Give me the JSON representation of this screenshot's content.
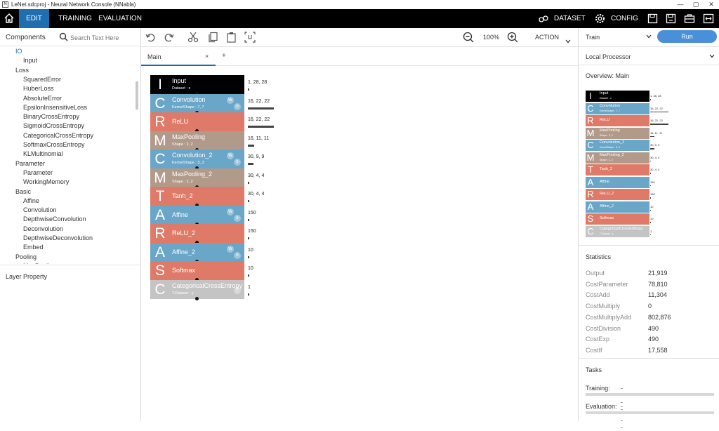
{
  "window": {
    "title": "LeNet.sdcproj - Neural Network Console (NNabla)",
    "icon_letter": "N",
    "controls": [
      "—",
      "▢",
      "✕"
    ]
  },
  "menu": {
    "home_icon": "home-icon",
    "tabs": [
      "EDIT",
      "TRAINING",
      "EVALUATION"
    ],
    "dataset_label": "DATASET",
    "config_label": "CONFIG",
    "accent": "#1f6fb0"
  },
  "components": {
    "title": "Components",
    "search_placeholder": "Search Text Here",
    "items": [
      {
        "label": "IO",
        "level": 0,
        "selected": true
      },
      {
        "label": "Input",
        "level": 1
      },
      {
        "label": "Loss",
        "level": 0
      },
      {
        "label": "SquaredError",
        "level": 1
      },
      {
        "label": "HuberLoss",
        "level": 1
      },
      {
        "label": "AbsoluteError",
        "level": 1
      },
      {
        "label": "EpsilonInsensitiveLoss",
        "level": 1
      },
      {
        "label": "BinaryCrossEntropy",
        "level": 1
      },
      {
        "label": "SigmoidCrossEntropy",
        "level": 1
      },
      {
        "label": "CategoricalCrossEntropy",
        "level": 1
      },
      {
        "label": "SoftmaxCrossEntropy",
        "level": 1
      },
      {
        "label": "KLMultinomial",
        "level": 1
      },
      {
        "label": "Parameter",
        "level": 0
      },
      {
        "label": "Parameter",
        "level": 1
      },
      {
        "label": "WorkingMemory",
        "level": 1
      },
      {
        "label": "Basic",
        "level": 0
      },
      {
        "label": "Affine",
        "level": 1
      },
      {
        "label": "Convolution",
        "level": 1
      },
      {
        "label": "DepthwiseConvolution",
        "level": 1
      },
      {
        "label": "Deconvolution",
        "level": 1
      },
      {
        "label": "DepthwiseDeconvolution",
        "level": 1
      },
      {
        "label": "Embed",
        "level": 1
      },
      {
        "label": "Pooling",
        "level": 0
      },
      {
        "label": "MaxPooling",
        "level": 1
      }
    ]
  },
  "layer_property": {
    "title": "Layer Property"
  },
  "toolbar": {
    "zoom_level": "100%",
    "action_label": "ACTION"
  },
  "tabs": {
    "main_label": "Main",
    "close": "×",
    "add": "+"
  },
  "network": {
    "layers": [
      {
        "letter": "I",
        "name": "Input",
        "sub": "Dataset : x",
        "color": "#000000",
        "shape": "1, 28, 28",
        "bar": 0.05,
        "wb": ""
      },
      {
        "letter": "C",
        "name": "Convolution",
        "sub": "KernelShape : 7, 7",
        "color": "#6aa6c8",
        "shape": "16, 22, 22",
        "bar": 0.93,
        "wb": "wb"
      },
      {
        "letter": "R",
        "name": "ReLU",
        "sub": "",
        "color": "#e07a68",
        "shape": "16, 22, 22",
        "bar": 0.93,
        "wb": ""
      },
      {
        "letter": "M",
        "name": "MaxPooling",
        "sub": "Shape : 2, 2",
        "color": "#b29a8a",
        "shape": "16, 11, 11",
        "bar": 0.23,
        "wb": ""
      },
      {
        "letter": "C",
        "name": "Convolution_2",
        "sub": "KernelShape : 3, 3",
        "color": "#6aa6c8",
        "shape": "30, 9, 9",
        "bar": 0.2,
        "wb": "wb"
      },
      {
        "letter": "M",
        "name": "MaxPooling_2",
        "sub": "Shape : 2, 2",
        "color": "#b29a8a",
        "shape": "30, 4, 4",
        "bar": 0.05,
        "wb": ""
      },
      {
        "letter": "T",
        "name": "Tanh_2",
        "sub": "",
        "color": "#e07a68",
        "shape": "30, 4, 4",
        "bar": 0.05,
        "wb": ""
      },
      {
        "letter": "A",
        "name": "Affine",
        "sub": "",
        "color": "#6aa6c8",
        "shape": "150",
        "bar": 0.02,
        "wb": "wb"
      },
      {
        "letter": "R",
        "name": "ReLU_2",
        "sub": "",
        "color": "#e07a68",
        "shape": "150",
        "bar": 0.02,
        "wb": ""
      },
      {
        "letter": "A",
        "name": "Affine_2",
        "sub": "",
        "color": "#6aa6c8",
        "shape": "10",
        "bar": 0.0,
        "wb": "wb"
      },
      {
        "letter": "S",
        "name": "Softmax",
        "sub": "",
        "color": "#e07a68",
        "shape": "10",
        "bar": 0.0,
        "wb": ""
      },
      {
        "letter": "C",
        "name": "CategoricalCrossEntropy",
        "sub": "T.Dataset : y",
        "color": "#c4c4c4",
        "shape": "1",
        "bar": 0.0,
        "wb": "t"
      }
    ]
  },
  "right": {
    "train_label": "Train",
    "run_label": "Run",
    "processor_label": "Local Processor",
    "overview_title": "Overview: Main",
    "stats_title": "Statistics",
    "stats": [
      {
        "k": "Output",
        "v": "21,919"
      },
      {
        "k": "CostParameter",
        "v": "78,810"
      },
      {
        "k": "CostAdd",
        "v": "11,304"
      },
      {
        "k": "CostMultiply",
        "v": "0"
      },
      {
        "k": "CostMultiplyAdd",
        "v": "802,876"
      },
      {
        "k": "CostDivision",
        "v": "490"
      },
      {
        "k": "CostExp",
        "v": "490"
      },
      {
        "k": "CostIf",
        "v": "17,558"
      }
    ],
    "tasks_title": "Tasks",
    "training_label": "Training:",
    "training_value": "----",
    "evaluation_label": "Evaluation:",
    "evaluation_value": "----"
  }
}
